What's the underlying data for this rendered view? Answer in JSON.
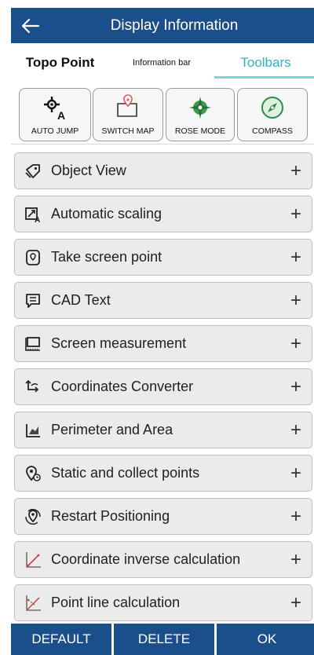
{
  "header": {
    "title": "Display Information",
    "back_icon": "back-arrow-icon"
  },
  "tabs": [
    {
      "label": "Topo Point",
      "active": false
    },
    {
      "label": "Information bar",
      "active": false
    },
    {
      "label": "Toolbars",
      "active": true
    }
  ],
  "toolbar": [
    {
      "label": "AUTO JUMP",
      "icon": "auto-jump-icon"
    },
    {
      "label": "SWITCH MAP",
      "icon": "switch-map-icon"
    },
    {
      "label": "ROSE MODE",
      "icon": "rose-mode-icon"
    },
    {
      "label": "COMPASS",
      "icon": "compass-icon"
    }
  ],
  "items": [
    {
      "label": "Object View",
      "icon": "object-view-icon"
    },
    {
      "label": "Automatic scaling",
      "icon": "automatic-scaling-icon"
    },
    {
      "label": "Take screen point",
      "icon": "take-screen-point-icon"
    },
    {
      "label": "CAD Text",
      "icon": "cad-text-icon"
    },
    {
      "label": "Screen measurement",
      "icon": "screen-measurement-icon"
    },
    {
      "label": "Coordinates Converter",
      "icon": "coordinates-converter-icon"
    },
    {
      "label": "Perimeter and Area",
      "icon": "perimeter-area-icon"
    },
    {
      "label": "Static and collect points",
      "icon": "static-collect-icon"
    },
    {
      "label": "Restart Positioning",
      "icon": "restart-positioning-icon"
    },
    {
      "label": "Coordinate inverse calculation",
      "icon": "inverse-calculation-icon"
    },
    {
      "label": "Point line calculation",
      "icon": "point-line-calculation-icon"
    }
  ],
  "plus_symbol": "+",
  "buttons": {
    "default": "DEFAULT",
    "delete": "DELETE",
    "ok": "OK"
  },
  "colors": {
    "primary": "#1b4f8c",
    "tab_active": "#2eb0c8",
    "row_bg": "#ebebeb"
  }
}
